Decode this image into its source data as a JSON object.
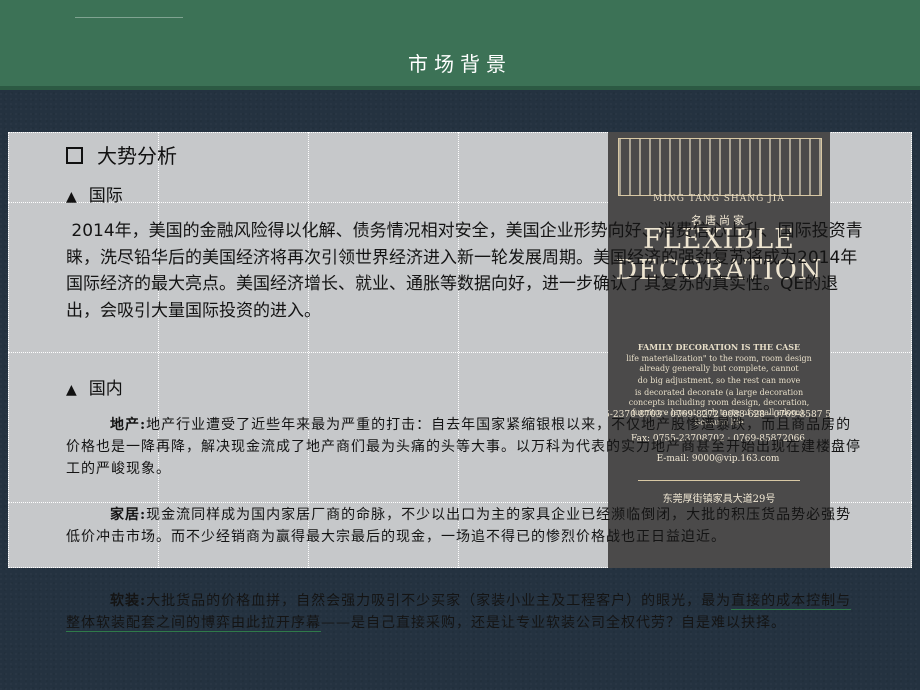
{
  "slide": {
    "title": "市场背景"
  },
  "section": {
    "heading": "大势分析",
    "international": {
      "marker": "▲",
      "label": "国际",
      "text": "2014年，美国的金融风险得以化解、债务情况相对安全，美国企业形势向好、消费信心上升、国际投资青睐，洗尽铅华后的美国经济将再次引领世界经济进入新一轮发展周期。美国经济的强劲复苏将成为2014年国际经济的最大亮点。美国经济增长、就业、通胀等数据向好，进一步确认了其复苏的真实性。QE的退出，会吸引大量国际投资的进入。"
    },
    "domestic": {
      "marker": "▲",
      "label": "国内",
      "real_estate_label": "地产:",
      "real_estate_text": "地产行业遭受了近些年来最为严重的打击：自去年国家紧缩银根以来，不仅地产股惨遭暴跌，而且商品房的价格也是一降再降，解决现金流成了地产商们最为头痛的头等大事。以万科为代表的实力地产商甚至开始出现在建楼盘停工的严峻现象。",
      "furniture_label": "家居:",
      "furniture_text": "现金流同样成为国内家居厂商的命脉，不少以出口为主的家具企业已经濒临倒闭，大批的积压货品势必强势低价冲击市场。而不少经销商为赢得最大宗最后的现金，一场追不得已的惨烈价格战也正日益迫近。",
      "softdecor_label": "软装:",
      "softdecor_text_before": "大批货品的价格血拼，自然会强力吸引不少买家（家装小业主及工程客户）的眼光，最为",
      "softdecor_text_underlined": "直接的成本控制与整体软装配套之间的博弈由此拉开序幕",
      "softdecor_text_after": "——是自己直接采购，还是让专业软装公司全权代劳？自是难以抉择。"
    }
  },
  "advert": {
    "building_sub": "MING TANG SHANG JIA",
    "brand_cn": "名唐尚家",
    "brand_en": "FLEXIBLE DECORATION",
    "tagline_title": "FAMILY DECORATION IS THE CASE",
    "tagline_1": "life materialization\" to the room, room design already generally but complete, cannot",
    "tagline_2": "do big adjustment, so the rest can move",
    "tagline_3": "is decorated decorate (a large decoration concepts including room design, decoration, furniture layout, rich taste of small adorn). Because life",
    "tel": "Tel: 0755-2370 8703  ·  0769-8272 0088-628  ·  0769-8587 5722-628",
    "fax": "Fax: 0755-23708702  ·  0769-85872066",
    "email": "E-mail: 9000@vip.163.com",
    "address": "东莞厚街镇家具大道29号"
  },
  "colors": {
    "header": "#3c7256",
    "background": "#243240",
    "content_panel": "#c6c8ca",
    "advert": "#4b4a4a",
    "underline": "#2f7a4a"
  }
}
